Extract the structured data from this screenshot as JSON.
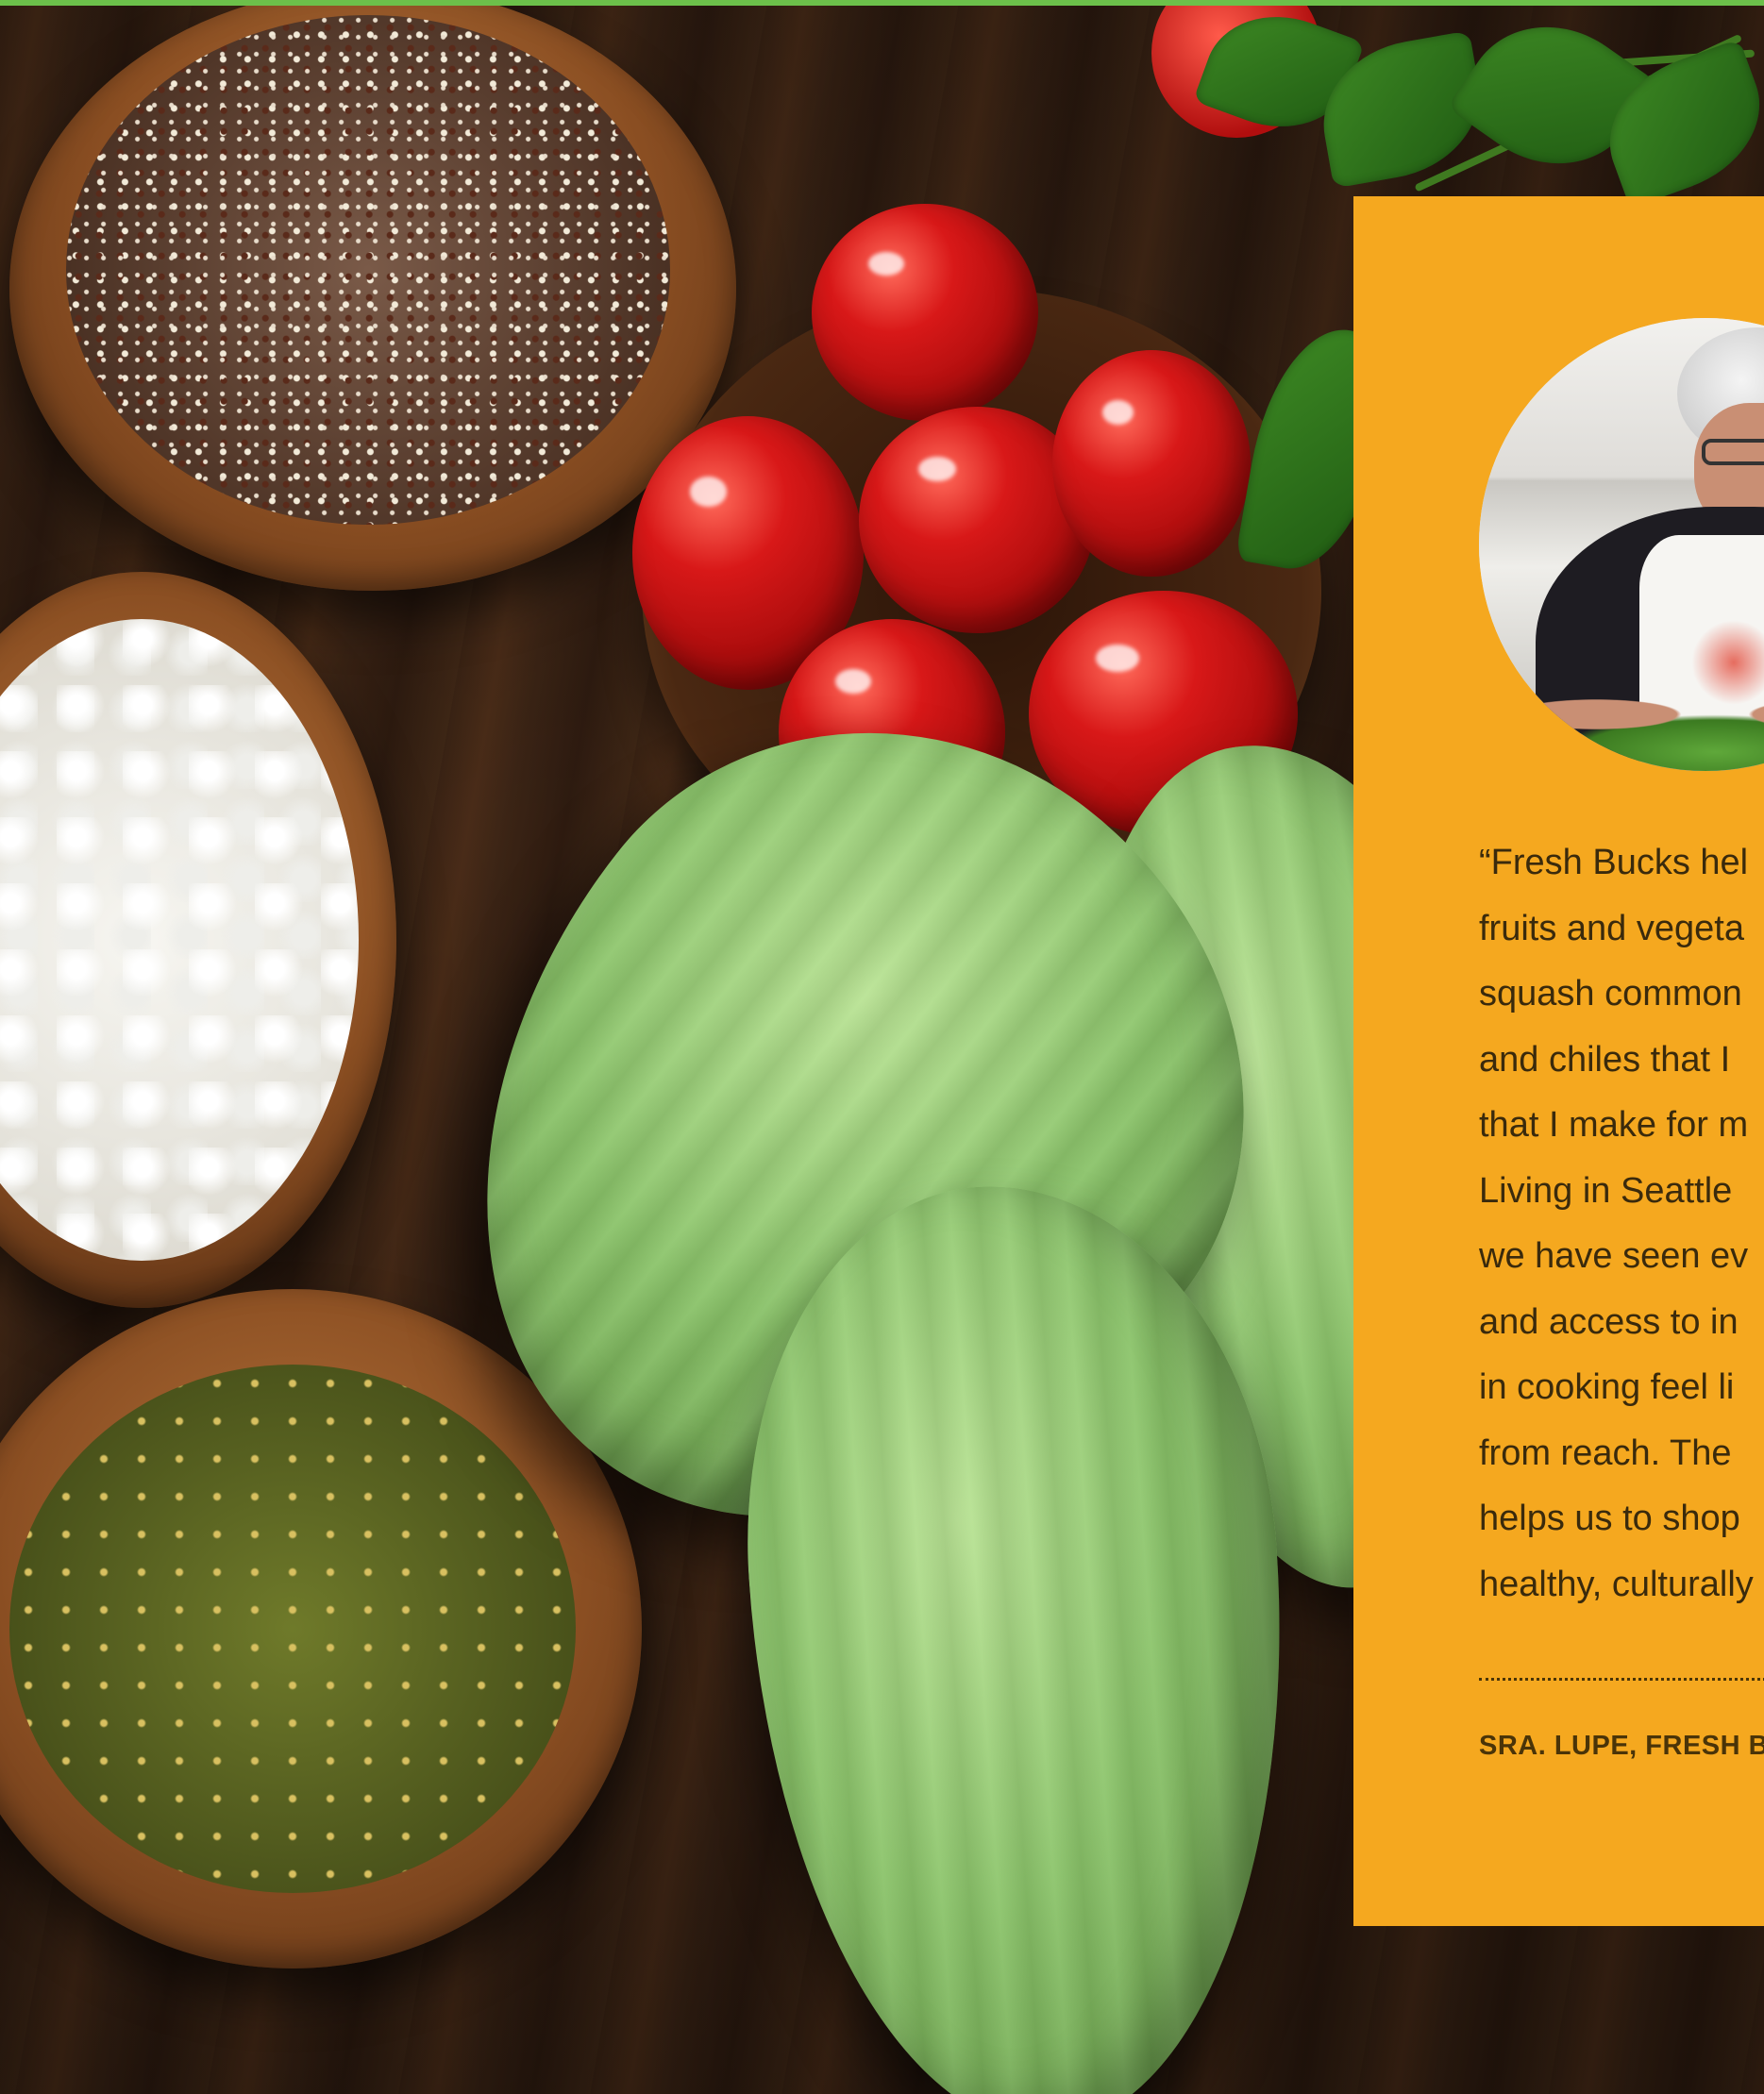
{
  "testimonial": {
    "quote_lines": [
      "“Fresh Bucks hel",
      "fruits and vegeta",
      "squash common",
      "and chiles that I",
      "that I make for m",
      "Living in Seattle",
      "we have seen ev",
      "and access to in",
      "in cooking feel li",
      "from reach. The",
      "helps us to shop",
      "healthy, culturally"
    ],
    "attribution": "SRA. LUPE, FRESH B"
  },
  "colors": {
    "accent_bar": "#6cc04a",
    "card_background": "#f5a81f",
    "text": "#3a2a0c"
  },
  "icons": {
    "avatar": "portrait-photo",
    "hero": "food-photo"
  }
}
